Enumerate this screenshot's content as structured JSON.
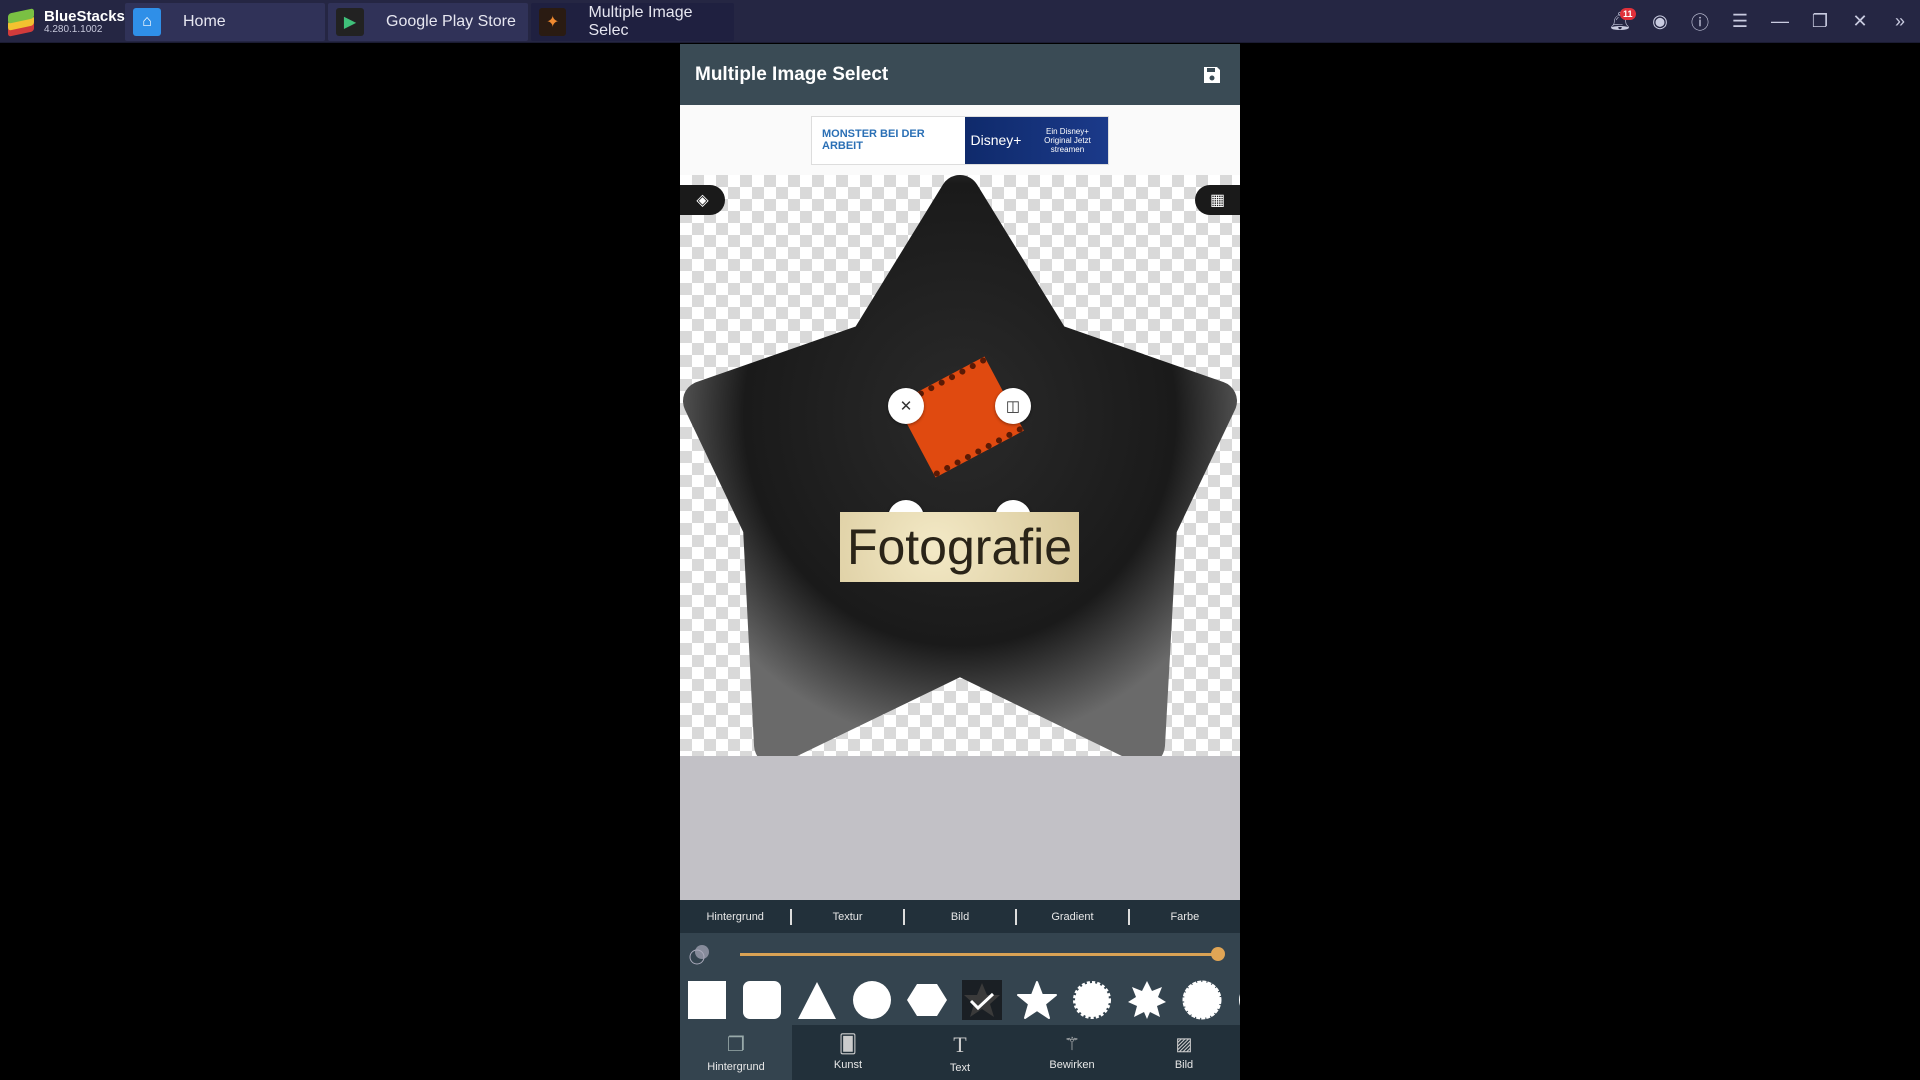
{
  "window": {
    "brand": "BlueStacks",
    "version": "4.280.1.1002",
    "notifications": "11",
    "tabs": [
      {
        "label": "Home",
        "icon": "home-icon"
      },
      {
        "label": "Google Play Store",
        "icon": "play-store-icon"
      },
      {
        "label": "Multiple Image Selec",
        "icon": "app-icon",
        "active": true
      }
    ]
  },
  "app": {
    "title": "Multiple Image Select",
    "ad": {
      "left": "MONSTER BEI DER ARBEIT",
      "brand": "Disney+",
      "right": "Ein Disney+ Original Jetzt streamen"
    },
    "canvas": {
      "text": "Fotografie",
      "shape": "star",
      "shape_color": "#1e1e1e",
      "sticker_color": "#e04a10"
    },
    "subtabs": [
      "Hintergrund",
      "Textur",
      "Bild",
      "Gradient",
      "Farbe"
    ],
    "opacity_percent": 100,
    "shapes": [
      "square",
      "rounded-square",
      "triangle",
      "circle",
      "hexagon",
      "star-selected",
      "star",
      "scalloped-circle",
      "eight-point-star",
      "scalloped-circle-2"
    ],
    "bottom_nav": [
      {
        "label": "Hintergrund",
        "icon": "background-icon",
        "active": true
      },
      {
        "label": "Kunst",
        "icon": "cards-icon"
      },
      {
        "label": "Text",
        "icon": "text-icon"
      },
      {
        "label": "Bewirken",
        "icon": "magic-wand-icon"
      },
      {
        "label": "Bild",
        "icon": "image-icon"
      }
    ]
  },
  "colors": {
    "accent": "#e0a555",
    "header": "#3a4b55",
    "toolbar": "#22303a"
  }
}
